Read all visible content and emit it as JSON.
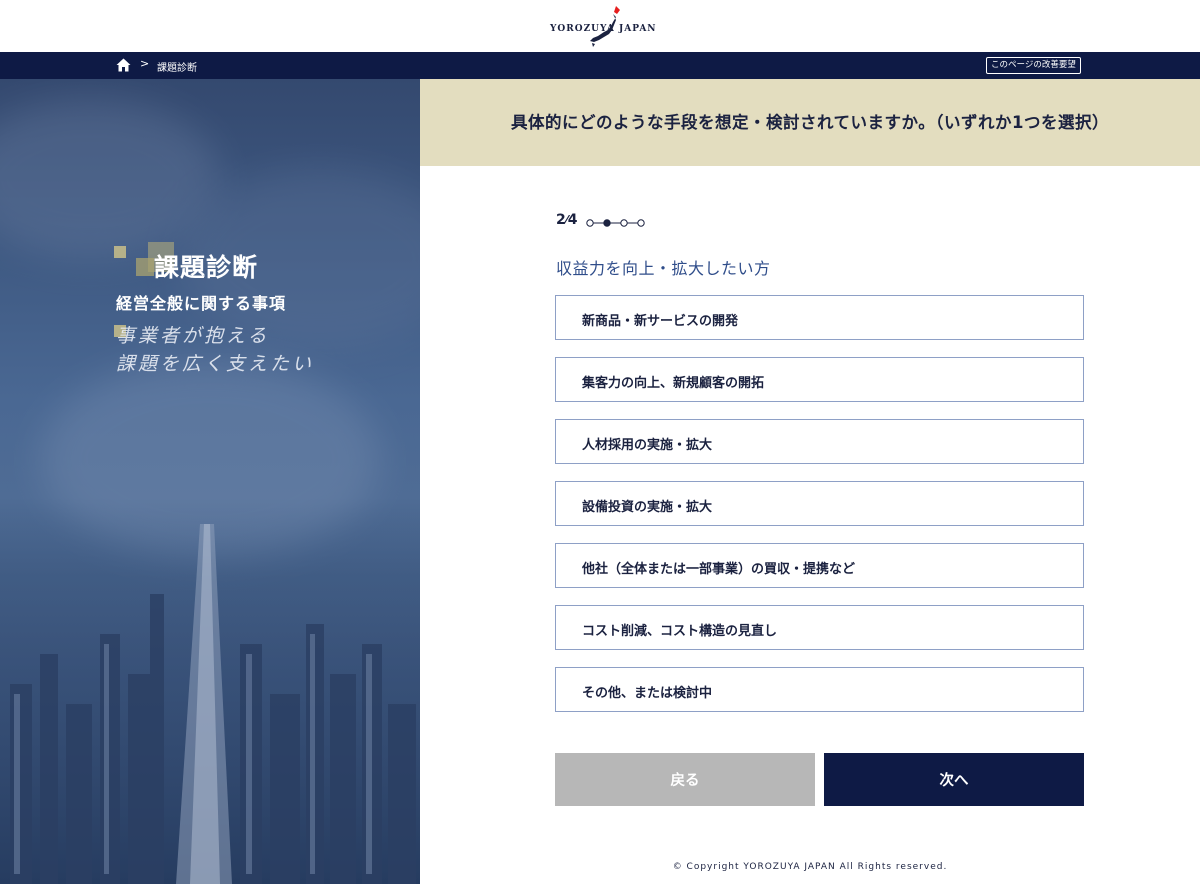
{
  "header": {
    "logo_text": "YOROZUYA JAPAN",
    "brand_red": "#e61e1e",
    "brand_navy": "#0e1a45"
  },
  "breadcrumb": {
    "home_icon": "home-icon",
    "separator": ">",
    "current": "課題診断",
    "improve_link": "このページの改善要望"
  },
  "hero": {
    "title": "課題診断",
    "subtitle": "経営全般に関する事項",
    "script_line1": "事業者が抱える",
    "script_line2": "課題を広く支えたい"
  },
  "question": {
    "text": "具体的にどのような手段を想定・検討されていますか。（いずれか1つを選択）"
  },
  "progress": {
    "current": "2",
    "total": "4",
    "current_step": 2,
    "total_steps": 4
  },
  "category_label": "収益力を向上・拡大したい方",
  "options": [
    "新商品・新サービスの開発",
    "集客力の向上、新規顧客の開拓",
    "人材採用の実施・拡大",
    "設備投資の実施・拡大",
    "他社（全体または一部事業）の買収・提携など",
    "コスト削減、コスト構造の見直し",
    "その他、または検討中"
  ],
  "buttons": {
    "back": "戻る",
    "next": "次へ"
  },
  "footer": {
    "copyright": "© Copyright YOROZUYA JAPAN All Rights reserved."
  },
  "colors": {
    "question_band": "#e3ddbf",
    "option_border": "#8ea0c6",
    "category_text": "#2f4d8a",
    "back_button": "#b7b7b7",
    "next_button": "#0e1a45"
  }
}
